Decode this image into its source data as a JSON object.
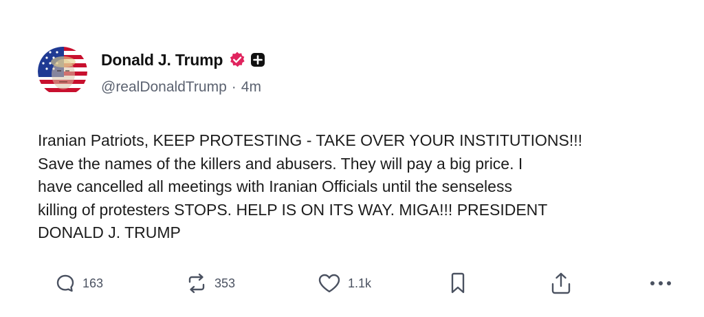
{
  "post": {
    "author": {
      "display_name": "Donald J. Trump",
      "handle": "@realDonaldTrump",
      "separator": "·",
      "timestamp": "4m",
      "verified_badge_icon": "verified-badge-icon",
      "extra_badge_icon": "plus-square-icon",
      "colors": {
        "verified_badge": "#e0245e"
      }
    },
    "text": "Iranian Patriots, KEEP PROTESTING - TAKE OVER YOUR INSTITUTIONS!!!\nSave the names of the killers and abusers. They will pay a big price. I\nhave cancelled all meetings with Iranian Officials until the senseless\nkilling of protesters STOPS. HELP IS ON ITS WAY. MIGA!!! PRESIDENT\nDONALD J. TRUMP",
    "actions": {
      "reply": {
        "icon": "reply-icon",
        "count": "163"
      },
      "repost": {
        "icon": "repost-icon",
        "count": "353"
      },
      "like": {
        "icon": "heart-icon",
        "count": "1.1k"
      },
      "bookmark": {
        "icon": "bookmark-icon"
      },
      "share": {
        "icon": "share-icon"
      },
      "more": {
        "icon": "more-icon"
      }
    }
  }
}
